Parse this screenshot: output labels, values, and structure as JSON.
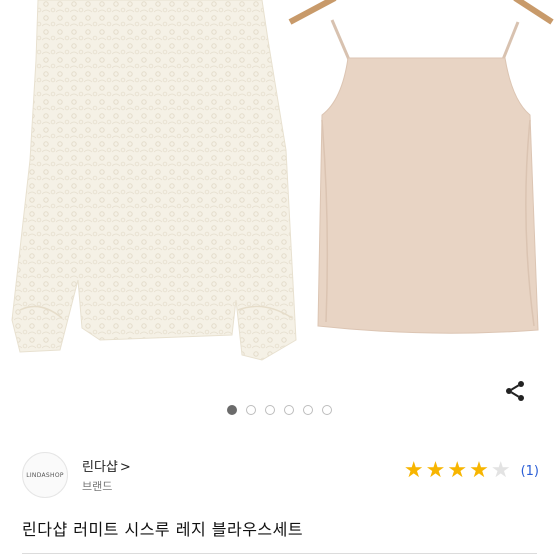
{
  "product_images": {
    "current_index": 1,
    "total": 6
  },
  "share": {
    "icon": "share-icon"
  },
  "seller": {
    "logo_text": "LINDASHOP",
    "name": "린다샵",
    "chevron": ">",
    "sub_label": "브랜드"
  },
  "rating": {
    "stars": 4,
    "max": 5,
    "review_count": "(1)"
  },
  "product": {
    "title": "린다샵 러미트 시스루 레지 블라우스세트"
  },
  "colors": {
    "star_active": "#f7b500",
    "star_inactive": "#e3e3e3",
    "review_link": "#2c5fd6",
    "dot_active": "#6b6b6b"
  }
}
